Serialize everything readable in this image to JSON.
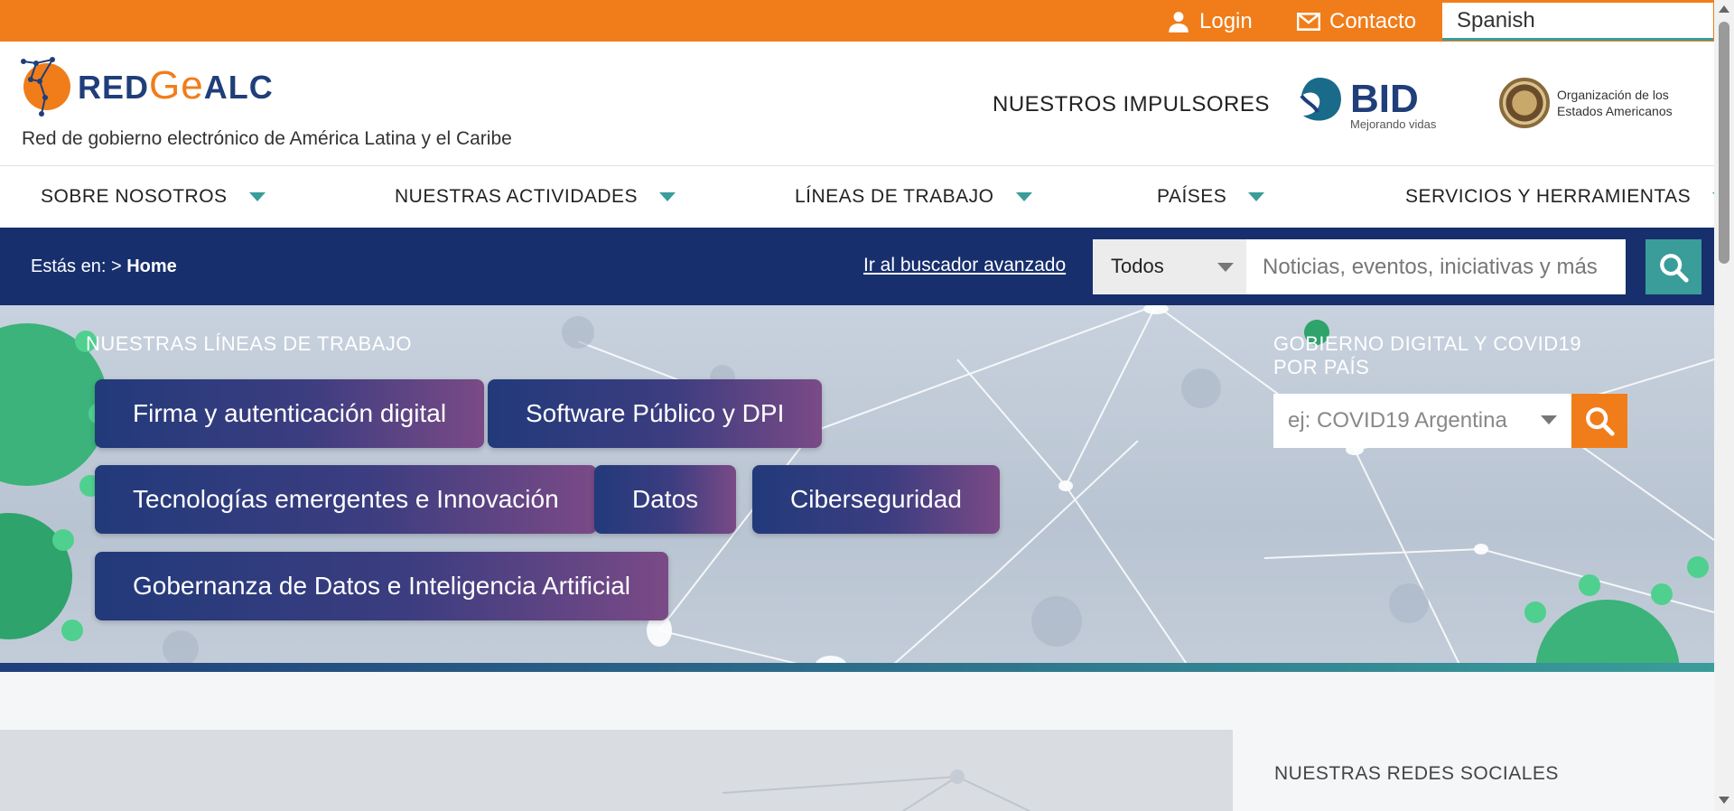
{
  "topbar": {
    "login": "Login",
    "contacto": "Contacto",
    "language": "Spanish"
  },
  "header": {
    "logo_red": "RED",
    "logo_ge": "Ge",
    "logo_alc": "ALC",
    "tagline": "Red de gobierno electrónico de América Latina y el Caribe",
    "impulsores": "NUESTROS IMPULSORES",
    "bid": "BID",
    "bid_sub": "Mejorando vidas",
    "oea_line1": "Organización de los",
    "oea_line2": "Estados Americanos"
  },
  "nav": {
    "items": [
      {
        "label": "SOBRE NOSOTROS"
      },
      {
        "label": "NUESTRAS ACTIVIDADES"
      },
      {
        "label": "LÍNEAS DE TRABAJO"
      },
      {
        "label": "PAÍSES"
      },
      {
        "label": "SERVICIOS Y HERRAMIENTAS"
      }
    ]
  },
  "searchbar": {
    "crumb_prefix": "Estás en:",
    "crumb_sep": ">",
    "crumb_current": "Home",
    "advanced_link": "Ir al buscador avanzado",
    "filter_value": "Todos",
    "placeholder": "Noticias, eventos, iniciativas y más"
  },
  "hero": {
    "title": "NUESTRAS LÍNEAS DE TRABAJO",
    "pills": [
      {
        "label": "Firma y autenticación digital"
      },
      {
        "label": "Software Público y DPI"
      },
      {
        "label": "Tecnologías emergentes e Innovación"
      },
      {
        "label": "Datos"
      },
      {
        "label": "Ciberseguridad"
      },
      {
        "label": "Gobernanza de Datos e Inteligencia Artificial"
      }
    ],
    "covid_title": "GOBIERNO DIGITAL Y COVID19 POR PAÍS",
    "covid_placeholder": "ej: COVID19 Argentina"
  },
  "lower": {
    "redes_title": "NUESTRAS REDES SOCIALES"
  },
  "colors": {
    "accent_orange": "#f07d1a",
    "navy": "#172f6d",
    "teal": "#3a9d9a"
  }
}
